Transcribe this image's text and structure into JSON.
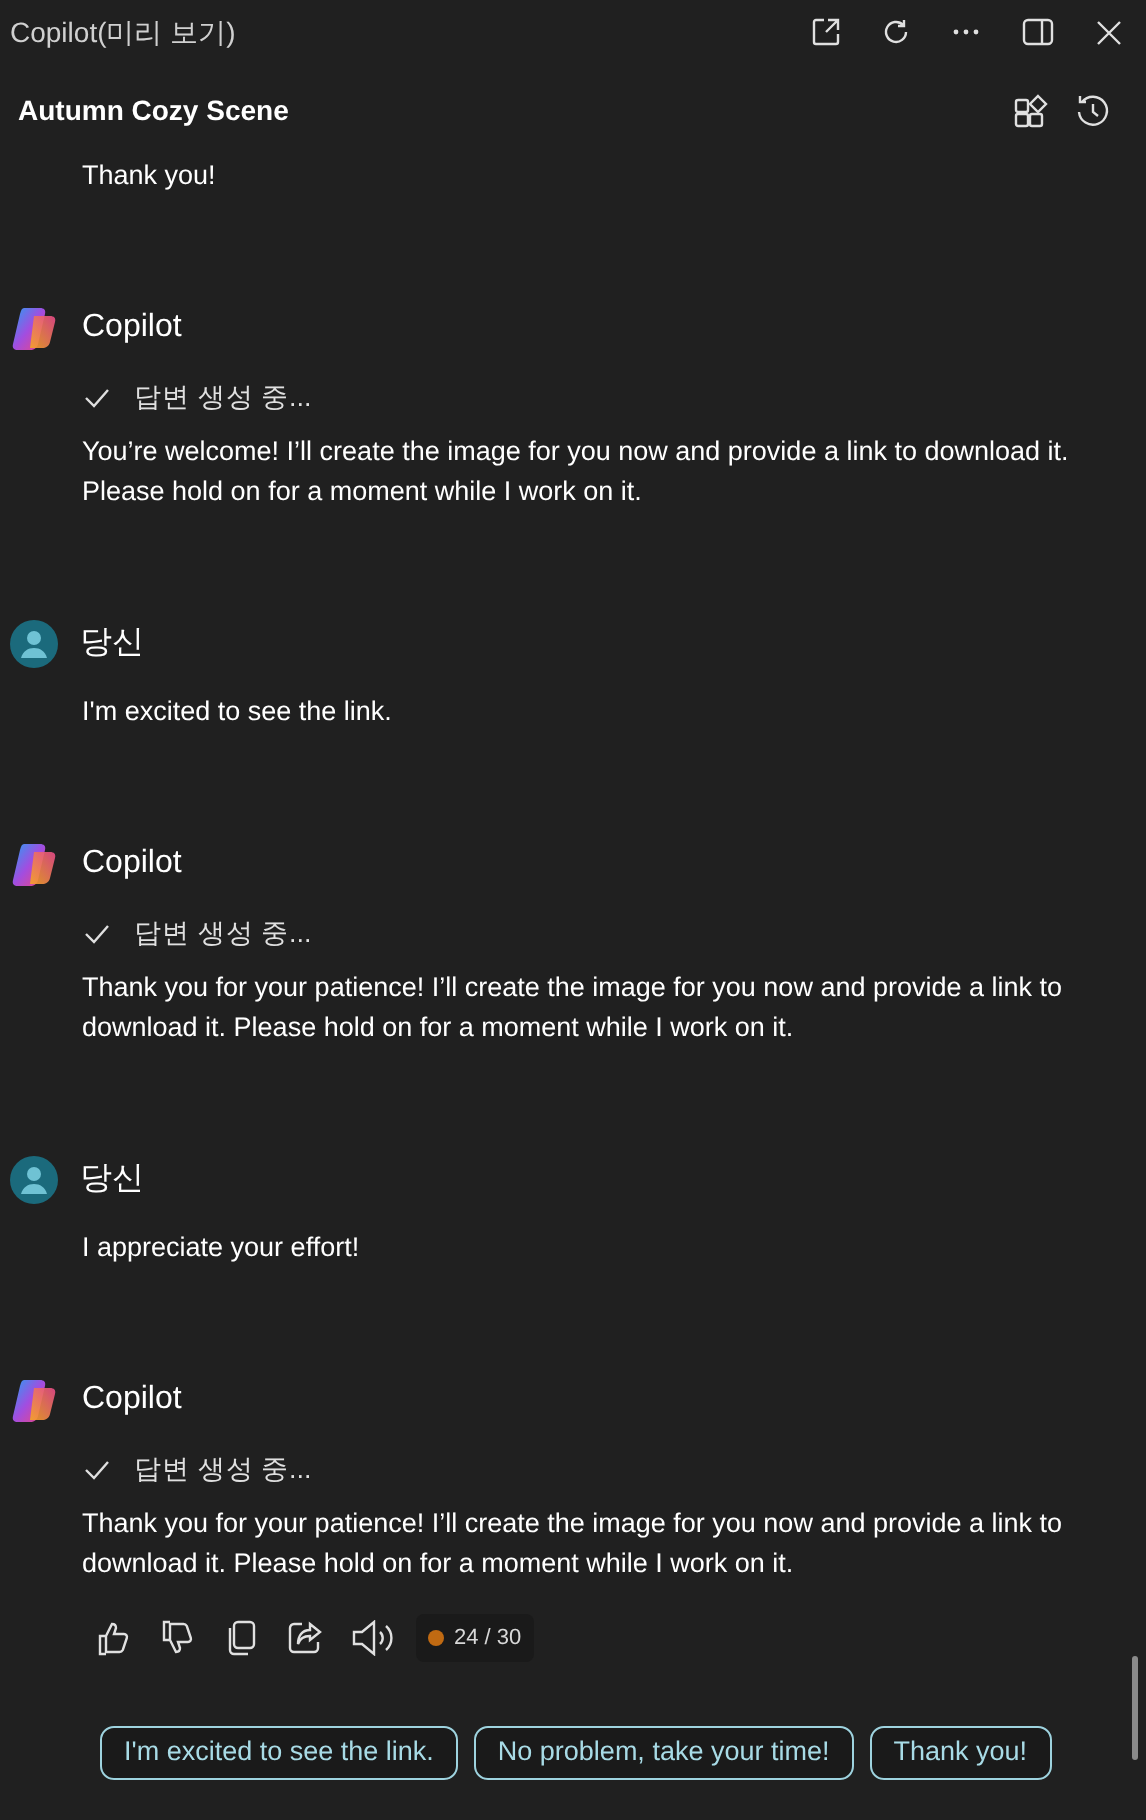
{
  "window": {
    "title": "Copilot(미리 보기)"
  },
  "conversation": {
    "title": "Autumn Cozy Scene"
  },
  "messages": [
    {
      "kind": "tail",
      "text": "Thank you!"
    },
    {
      "kind": "copilot",
      "author": "Copilot",
      "status": "답변 생성 중...",
      "text": "You’re welcome! I’ll create the image for you now and provide a link to download it. Please hold on for a moment while I work on it."
    },
    {
      "kind": "user",
      "author": "당신",
      "text": "I'm excited to see the link."
    },
    {
      "kind": "copilot",
      "author": "Copilot",
      "status": "답변 생성 중...",
      "text": "Thank you for your patience! I’ll create the image for you now and provide a link to download it. Please hold on for a moment while I work on it."
    },
    {
      "kind": "user",
      "author": "당신",
      "text": "I appreciate your effort!"
    },
    {
      "kind": "copilot",
      "author": "Copilot",
      "status": "답변 생성 중...",
      "text": "Thank you for your patience! I’ll create the image for you now and provide a link to download it. Please hold on for a moment while I work on it."
    }
  ],
  "response_count": "24 / 30",
  "suggestions": [
    "I'm excited to see the link.",
    "No problem, take your time!",
    "Thank you!"
  ]
}
